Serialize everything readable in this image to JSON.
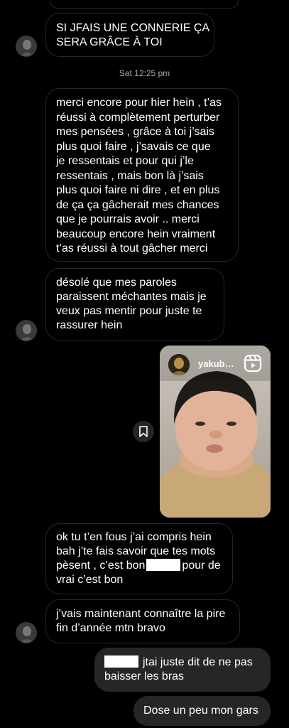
{
  "messages": [
    {
      "lines": [
        "SI JFAIS UNE CONNERIE ÇA",
        "SERA GRÂCE À TOI"
      ]
    },
    {
      "lines": [
        "merci encore pour hier hein , t’as",
        "réussi à complètement perturber",
        "mes pensées , grâce à toi j’sais",
        "plus quoi faire , j’savais ce que",
        "je ressentais et pour qui j’le",
        "ressentais , mais bon là j’sais",
        "plus quoi faire ni dire , et en plus",
        "de ça ça gâcherait mes chances",
        "que je pourrais avoir .. merci",
        "beaucoup encore hein vraiment",
        "t’as réussi à tout gâcher merci"
      ]
    },
    {
      "lines": [
        "désolé que mes paroles",
        "paraissent méchantes mais je",
        "veux pas mentir pour juste te",
        "rassurer hein"
      ]
    },
    {
      "lines": [
        "ok tu t’en fous j’ai compris hein",
        "bah j’te fais savoir que tes mots"
      ],
      "line3_before": "pèsent , c’est bon",
      "line3_after": "pour de",
      "line4": "vrai c’est bon"
    },
    {
      "lines": [
        "j’vais maintenant connaître la pire",
        "fin d’année mtn bravo"
      ]
    }
  ],
  "timestamp": "Sat 12:25 pm",
  "reel": {
    "username": "yakub…"
  },
  "outgoing": [
    {
      "line1_after": "jtai juste dit de ne pas",
      "line2": "baisser les bras"
    },
    {
      "text": "Dose un peu mon gars"
    }
  ],
  "colors": {
    "background": "#000000",
    "incoming_border": "#262626",
    "outgoing_bubble": "#262626",
    "timestamp": "#a8a8a8"
  }
}
